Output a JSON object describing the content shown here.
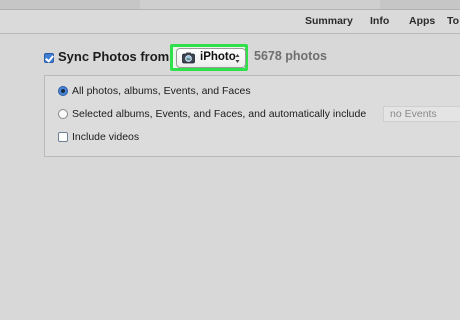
{
  "tabs": [
    {
      "label": "Summary"
    },
    {
      "label": "Info"
    },
    {
      "label": "Apps"
    },
    {
      "label": "To"
    }
  ],
  "sync": {
    "checkbox_checked": true,
    "label": "Sync Photos from",
    "source": {
      "label": "iPhoto",
      "icon": "iphoto-icon"
    },
    "count_text": "5678 photos"
  },
  "options": {
    "selected": "all",
    "all_label": "All photos, albums, Events, and Faces",
    "selected_label": "Selected albums, Events, and Faces, and automatically include",
    "events_value": "no Events",
    "include_videos_label": "Include videos",
    "include_videos_checked": false
  },
  "colors": {
    "highlight": "#2fe04a",
    "accent": "#3f7fd3"
  }
}
